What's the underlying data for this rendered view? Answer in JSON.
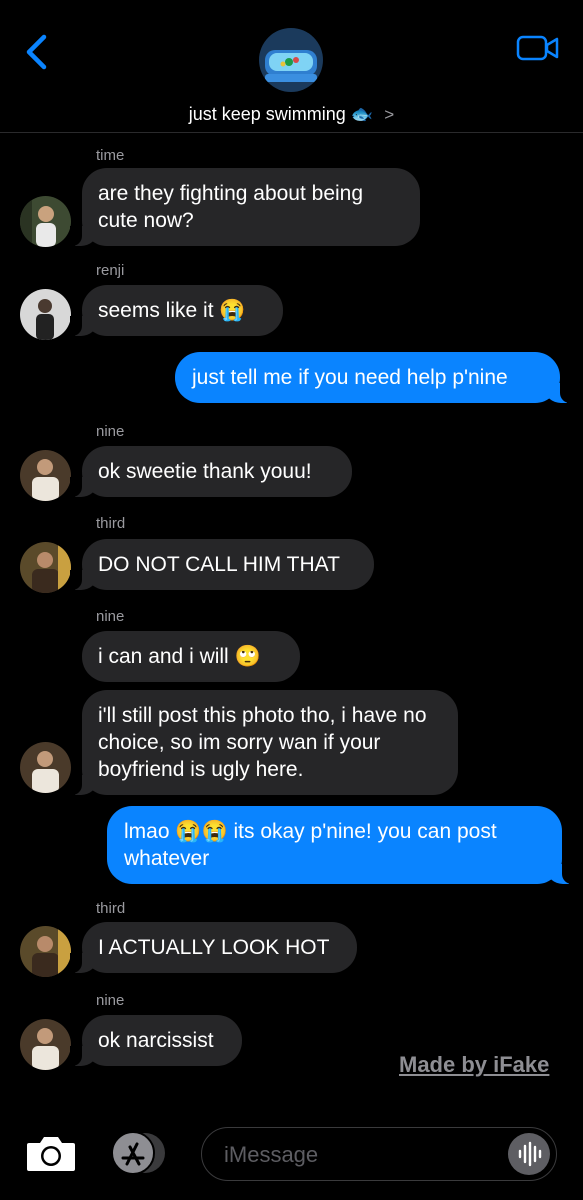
{
  "header": {
    "title": "just keep swimming",
    "title_emoji": "🐟",
    "chevron": ">",
    "back_icon": "chevron-left-icon",
    "video_icon": "video-camera-icon",
    "accent": "#0a84ff"
  },
  "messages": [
    {
      "sender": "time",
      "text": "are they fighting about being cute now?",
      "direction": "incoming"
    },
    {
      "sender": "renji",
      "text": "seems like it 😭",
      "direction": "incoming"
    },
    {
      "sender": "",
      "text": "just tell me if you need help p'nine",
      "direction": "outgoing"
    },
    {
      "sender": "nine",
      "text": "ok sweetie thank youu!",
      "direction": "incoming"
    },
    {
      "sender": "third",
      "text": "DO NOT CALL HIM THAT",
      "direction": "incoming"
    },
    {
      "sender": "nine",
      "text": "i can and i will 🙄",
      "direction": "incoming"
    },
    {
      "sender": "",
      "text": "i'll still post this photo tho, i have no choice, so im sorry wan if your boyfriend is ugly here.",
      "direction": "incoming"
    },
    {
      "sender": "",
      "text": "lmao 😭😭 its okay p'nine! you can post whatever",
      "direction": "outgoing"
    },
    {
      "sender": "third",
      "text": "I ACTUALLY LOOK HOT",
      "direction": "incoming"
    },
    {
      "sender": "nine",
      "text": "ok narcissist",
      "direction": "incoming"
    }
  ],
  "watermark": "Made by iFake",
  "composer": {
    "placeholder": "iMessage",
    "camera_icon": "camera-icon",
    "apps_icon": "app-store-icon",
    "audio_icon": "audio-waveform-icon"
  },
  "colors": {
    "incoming_bubble": "#262628",
    "outgoing_bubble": "#0a84ff",
    "background": "#000000"
  }
}
